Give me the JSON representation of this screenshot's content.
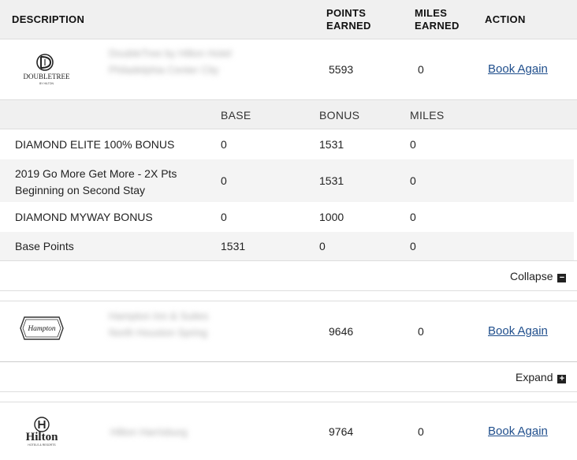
{
  "header": {
    "description": "DESCRIPTION",
    "points_earned_line1": "POINTS",
    "points_earned_line2": "EARNED",
    "miles_earned_line1": "MILES",
    "miles_earned_line2": "EARNED",
    "action": "ACTION"
  },
  "stays": [
    {
      "brand_logo": "doubletree-logo",
      "logo_text": "DOUBLETREE",
      "logo_subtext": "BY HILTON",
      "hotel_name_blurred": "DoubleTree by Hilton Hotel Philadelphia Center City",
      "points": "5593",
      "miles": "0",
      "action_label": "Book Again",
      "toggle_label": "Collapse",
      "toggle_symbol": "−"
    },
    {
      "brand_logo": "hampton-logo",
      "logo_text": "Hampton",
      "hotel_name_blurred": "Hampton Inn & Suites North Houston Spring",
      "points": "9646",
      "miles": "0",
      "action_label": "Book Again",
      "toggle_label": "Expand",
      "toggle_symbol": "+"
    },
    {
      "brand_logo": "hilton-logo",
      "logo_text": "Hilton",
      "logo_subtext": "HOTELS & RESORTS",
      "hotel_name_blurred": "Hilton Harrisburg",
      "points": "9764",
      "miles": "0",
      "action_label": "Book Again"
    }
  ],
  "detail": {
    "columns": [
      "BASE",
      "BONUS",
      "MILES"
    ],
    "rows": [
      {
        "desc_line1": "DIAMOND ELITE 100% BONUS",
        "desc_line2": "",
        "base": "0",
        "bonus": "1531",
        "miles": "0"
      },
      {
        "desc_line1": "2019 Go More Get More - 2X Pts",
        "desc_line2": "Beginning on Second Stay",
        "base": "0",
        "bonus": "1531",
        "miles": "0"
      },
      {
        "desc_line1": "DIAMOND MYWAY BONUS",
        "desc_line2": "",
        "base": "0",
        "bonus": "1000",
        "miles": "0"
      },
      {
        "desc_line1": "Base Points",
        "desc_line2": "",
        "base": "1531",
        "bonus": "0",
        "miles": "0"
      }
    ]
  }
}
